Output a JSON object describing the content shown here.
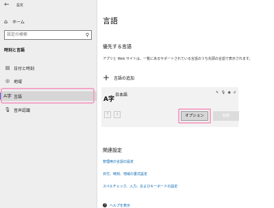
{
  "window": {
    "title": "設定"
  },
  "sidebar": {
    "home_label": "ホーム",
    "search_placeholder": "設定の検索",
    "section_title": "時刻と言語",
    "items": [
      {
        "label": "日付と時刻",
        "icon": "calendar-clock-icon"
      },
      {
        "label": "地域",
        "icon": "globe-icon"
      },
      {
        "label": "言語",
        "icon": "language-icon",
        "active": true
      },
      {
        "label": "音声認識",
        "icon": "microphone-icon"
      }
    ]
  },
  "main": {
    "title": "言語",
    "preferred_heading": "優先する言語",
    "description": "アプリと Web サイトは、一覧にあるサポートされている言語のうち先頭の言語で表示されます。",
    "add_language_label": "言語の追加",
    "language": {
      "name": "日本語",
      "icon_glyph": "A字"
    },
    "options_button": "オプション",
    "remove_button": "削除",
    "related_heading": "関連設定",
    "links": [
      "管理用の言語の設定",
      "日付、時刻、地域の書式設定",
      "スペルチェック、入力、およびキーボードの設定"
    ],
    "help_label": "ヘルプを表示"
  },
  "colors": {
    "accent": "#0078d7",
    "link": "#0063b1",
    "highlight": "#f3a6c8"
  }
}
